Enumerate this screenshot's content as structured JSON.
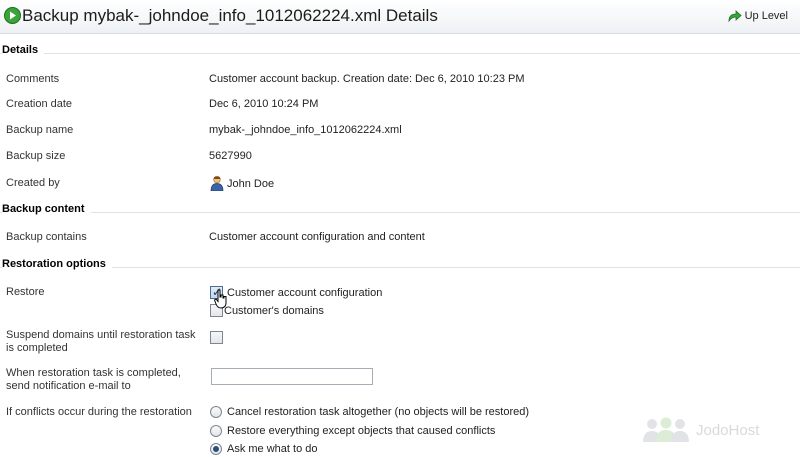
{
  "header": {
    "title": "Backup mybak-_johndoe_info_1012062224.xml Details",
    "up_level": "Up Level"
  },
  "sections": {
    "details": "Details",
    "backup_content": "Backup content",
    "restoration_options": "Restoration options"
  },
  "details": {
    "comments_label": "Comments",
    "comments_value": "Customer account backup. Creation date: Dec 6, 2010 10:23 PM",
    "creation_date_label": "Creation date",
    "creation_date_value": "Dec 6, 2010 10:24 PM",
    "backup_name_label": "Backup name",
    "backup_name_value": "mybak-_johndoe_info_1012062224.xml",
    "backup_size_label": "Backup size",
    "backup_size_value": "5627990",
    "created_by_label": "Created by",
    "created_by_value": "John Doe"
  },
  "content": {
    "contains_label": "Backup contains",
    "contains_value": "Customer account configuration and content"
  },
  "restoration": {
    "restore_label": "Restore",
    "opt_customer_config": "Customer account configuration",
    "opt_customer_domains": "Customer's domains",
    "suspend_label": "Suspend domains until restoration task is completed",
    "notify_label": "When restoration task is completed, send notification e-mail to",
    "notify_value": "",
    "conflicts_label": "If conflicts occur during the restoration",
    "conflict_cancel": "Cancel restoration task altogether (no objects will be restored)",
    "conflict_except": "Restore everything except objects that caused conflicts",
    "conflict_ask": "Ask me what to do"
  },
  "watermark": "JodoHost",
  "colors": {
    "accent_green": "#3aa33a",
    "section_line": "#dfe3e8",
    "header_bg": "#eef1f4"
  }
}
